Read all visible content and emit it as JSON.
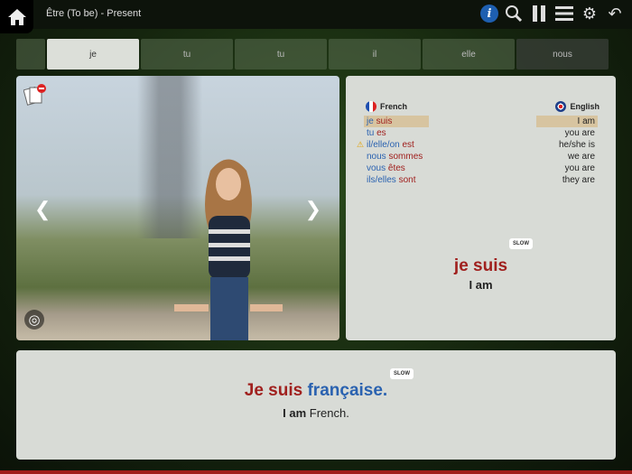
{
  "header": {
    "title": "Être (To be) - Present",
    "icons": [
      "home-icon",
      "info-icon",
      "zoom-text-icon",
      "pause-icon",
      "menu-icon",
      "settings-icon",
      "back-icon"
    ]
  },
  "tabs": [
    "je",
    "tu",
    "tu",
    "il",
    "elle",
    "nous"
  ],
  "conjugation": {
    "french_label": "French",
    "english_label": "English",
    "rows": [
      {
        "pronoun": "je",
        "verb": "suis",
        "english": "I am",
        "highlight": true
      },
      {
        "pronoun": "tu",
        "verb": "es",
        "english": "you are"
      },
      {
        "pronoun": "il/elle/on",
        "verb": "est",
        "english": "he/she is",
        "warning": true
      },
      {
        "pronoun": "nous",
        "verb": "sommes",
        "english": "we are"
      },
      {
        "pronoun": "vous",
        "verb": "êtes",
        "english": "you are"
      },
      {
        "pronoun": "ils/elles",
        "verb": "sont",
        "english": "they are"
      }
    ],
    "slow": "SLOW",
    "current_fr": "je suis",
    "current_en": "I am"
  },
  "sentence": {
    "slow": "SLOW",
    "fr_red": "Je suis",
    "fr_blue": "française.",
    "en_bold": "I am",
    "en_rest": "French."
  },
  "colors": {
    "blue": "#2a62b0",
    "red": "#a0201e",
    "accent_bar": "#a01d1a"
  }
}
